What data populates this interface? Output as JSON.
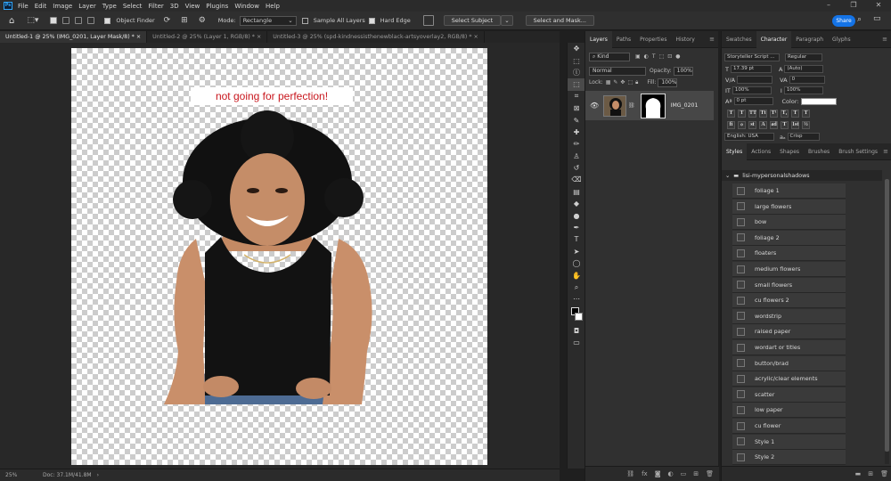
{
  "menubar": {
    "app_logo": "Ps",
    "items": [
      "File",
      "Edit",
      "Image",
      "Layer",
      "Type",
      "Select",
      "Filter",
      "3D",
      "View",
      "Plugins",
      "Window",
      "Help"
    ],
    "window_controls": [
      "–",
      "❐",
      "✕"
    ]
  },
  "options": {
    "object_finder": "Object Finder",
    "mode_label": "Mode:",
    "mode_value": "Rectangle",
    "sample_all_layers": "Sample All Layers",
    "sample_all_checked": false,
    "hard_edge": "Hard Edge",
    "hard_edge_checked": true,
    "select_subject": "Select Subject",
    "select_and_mask": "Select and Mask...",
    "share": "Share"
  },
  "doc_tabs": [
    {
      "label": "Untitled-1 @ 25% (IMG_0201, Layer Mask/8) *",
      "active": true
    },
    {
      "label": "Untitled-2 @ 25% (Layer 1, RGB/8) *",
      "active": false
    },
    {
      "label": "Untitled-3 @ 25% (spd-kindnessisthenewblack-artsyoverlay2, RGB/8) *",
      "active": false
    }
  ],
  "canvas": {
    "caption": "not going for perfection!",
    "caption_color": "#c8161d"
  },
  "status": {
    "zoom": "25%",
    "doc": "Doc: 37.1M/41.8M"
  },
  "layers_panel": {
    "tabs": [
      "Layers",
      "Paths",
      "Properties",
      "History"
    ],
    "active_tab": "Layers",
    "filter_kind": "Kind",
    "blend_mode": "Normal",
    "opacity_label": "Opacity:",
    "opacity": "100%",
    "lock_label": "Lock:",
    "fill_label": "Fill:",
    "fill": "100%",
    "layers": [
      {
        "name": "IMG_0201",
        "visible": true
      }
    ]
  },
  "right_dock": {
    "top_tabs": [
      "Swatches",
      "Character",
      "Paragraph",
      "Glyphs"
    ],
    "active_top_tab": "Character",
    "character": {
      "font_family": "Storyteller Script ...",
      "font_style": "Regular",
      "font_size": "17.39 pt",
      "leading": "(Auto)",
      "kerning": "",
      "tracking": "0",
      "vertical_scale": "100%",
      "horizontal_scale": "100%",
      "baseline_shift": "0 pt",
      "color_label": "Color:",
      "type_buttons": [
        "T",
        "T",
        "TT",
        "Tt",
        "T¹",
        "T₁",
        "T",
        "T"
      ],
      "opentype_buttons": [
        "fi",
        "ℴ",
        "st",
        "A",
        "ad",
        "T",
        "1st",
        "½"
      ],
      "language": "English: USA",
      "antialias_label": "aₐ",
      "antialias": "Crisp"
    },
    "bottom_tabs": [
      "Styles",
      "Actions",
      "Shapes",
      "Brushes",
      "Brush Settings"
    ],
    "active_bottom_tab": "Styles",
    "styles_group": "lisi-mypersonalshadows",
    "styles": [
      "foliage 1",
      "large flowers",
      "bow",
      "foliage 2",
      "floaters",
      "medium flowers",
      "small flowers",
      "cu flowers 2",
      "wordstrip",
      "raised paper",
      "wordart or titles",
      "button/brad",
      "acrylic/clear elements",
      "scatter",
      "low paper",
      "cu flower",
      "Style 1",
      "Style 2"
    ]
  },
  "colors": {
    "accent": "#1473e6",
    "foreground": "#000000",
    "background": "#ffffff"
  }
}
